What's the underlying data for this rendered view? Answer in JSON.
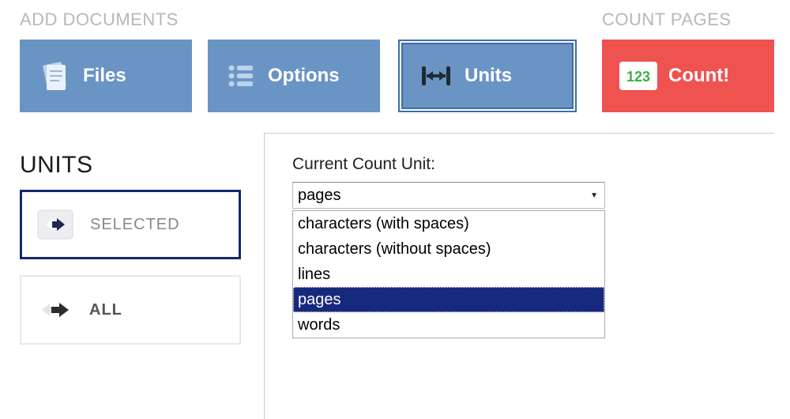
{
  "headers": {
    "add_documents": "ADD DOCUMENTS",
    "count_pages": "COUNT PAGES"
  },
  "toolbar": {
    "files_label": "Files",
    "options_label": "Options",
    "units_label": "Units",
    "count_label": "Count!"
  },
  "sidebar": {
    "title": "UNITS",
    "selected_label": "SELECTED",
    "all_label": "ALL"
  },
  "panel": {
    "current_unit_label": "Current Count Unit:",
    "selected_value": "pages",
    "options": {
      "0": "characters (with spaces)",
      "1": "characters (without spaces)",
      "2": "lines",
      "3": "pages",
      "4": "words"
    }
  },
  "colors": {
    "blue": "#6a94c4",
    "red": "#ef5350",
    "sel_border": "#132a6a",
    "list_highlight": "#17297c"
  }
}
